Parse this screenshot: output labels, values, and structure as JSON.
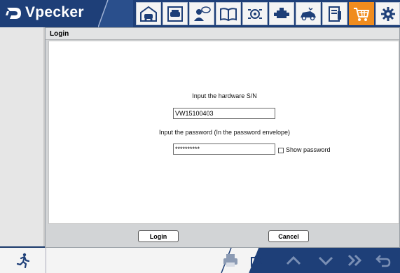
{
  "app": {
    "brand": "Vpecker"
  },
  "toolbar": {
    "buttons": [
      {
        "icon": "garage-icon"
      },
      {
        "icon": "car-diagnostics-icon"
      },
      {
        "icon": "user-chat-icon"
      },
      {
        "icon": "book-icon"
      },
      {
        "icon": "engine-settings-icon"
      },
      {
        "icon": "engine-icon"
      },
      {
        "icon": "car-crash-icon"
      },
      {
        "icon": "manual-info-icon"
      },
      {
        "icon": "shopping-cart-icon",
        "active": true
      },
      {
        "icon": "gear-icon"
      }
    ],
    "active_color": "#f08c1e"
  },
  "dialog": {
    "title": "Login",
    "serial_label": "Input the hardware S/N",
    "serial_value": "VW15100403",
    "password_label": "Input the password (In the password envelope)",
    "password_value": "**********",
    "show_password_label": "Show password",
    "login_button": "Login",
    "cancel_button": "Cancel"
  },
  "bottombar": {
    "left_icon": "running-man-icon",
    "icons": [
      "printer-icon",
      "camera-icon",
      "chevron-up-icon",
      "chevron-down-icon",
      "double-chevron-right-icon",
      "back-arrow-icon"
    ]
  },
  "colors": {
    "brand_blue": "#1e3f78",
    "accent_orange": "#f08c1e"
  }
}
